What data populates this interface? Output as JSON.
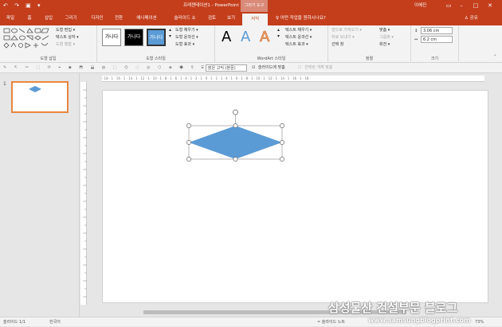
{
  "window": {
    "title": "프레젠테이션1 - PowerPoint",
    "context_tab": "그리기 도구",
    "user": "이혜진",
    "quick_access": "↶ ↷ ▣ ▾"
  },
  "tabs": [
    "파일",
    "홈",
    "삽입",
    "그리기",
    "디자인",
    "전환",
    "애니메이션",
    "슬라이드 쇼",
    "검토",
    "보기",
    "서식"
  ],
  "active_tab": "서식",
  "tell_me": "♀ 어떤 작업을 원하시나요?",
  "share": "♙ 공유",
  "ribbon": {
    "insert_shapes": {
      "label": "도형 삽입",
      "items": [
        "도형 편집 ▾",
        "텍스트 상자 ▾",
        "도형 병합 ▾"
      ]
    },
    "shape_styles": {
      "label": "도형 스타일",
      "thumbs": [
        "가나다",
        "가나다",
        "가나다"
      ],
      "items": [
        "도형 채우기 ▾",
        "도형 윤곽선 ▾",
        "도형 효과 ▾"
      ]
    },
    "wordart": {
      "label": "WordArt 스타일",
      "letters": [
        "A",
        "A",
        "A"
      ],
      "items": [
        "텍스트 채우기 ▾",
        "텍스트 윤곽선 ▾",
        "텍스트 효과 ▾"
      ]
    },
    "arrange": {
      "label": "정렬",
      "items": [
        "앞으로 가져오기 ▾",
        "뒤로 보내기 ▾",
        "선택 창",
        "맞춤 ▾",
        "그룹화 ▾",
        "회전 ▾"
      ]
    },
    "size": {
      "label": "크기",
      "height": "3.06 cm",
      "width": "6.2 cm"
    }
  },
  "toolbar2": {
    "font_name": "맑은 고딕 (본문)",
    "fit_option": "슬라이드에 맞춤",
    "select_all": "선택된 개체 맞춤"
  },
  "slide_panel": {
    "slide_number": "1"
  },
  "ruler_text": "· 18 · 1 · 16 · 1 · 14 · 1 · 12 · 1 · 10 · 1 · 8 · 1 · 6 · 1 · 4 · 1 · 2 · 1 · 0 · 1 · 2 · 1 · 4 · 1 · 6 · 1 · 8 · 1 · 10 · 1 · 12 · 1 · 14 · 1 · 16 · 1 · 18 ·",
  "shape": {
    "fill": "#5b9bd5",
    "type": "diamond"
  },
  "status": {
    "slide_info": "슬라이드 1/1",
    "language": "한국어",
    "notes": "≐ 슬라이드 노트",
    "zoom": "73%"
  },
  "watermark": {
    "main": "삼성물산 건설부문 블로그",
    "url": "www.samsungblogprint.com"
  },
  "colors": {
    "accent": "#c43e1c",
    "shape": "#5b9bd5",
    "thumb_border": "#e8873e"
  }
}
